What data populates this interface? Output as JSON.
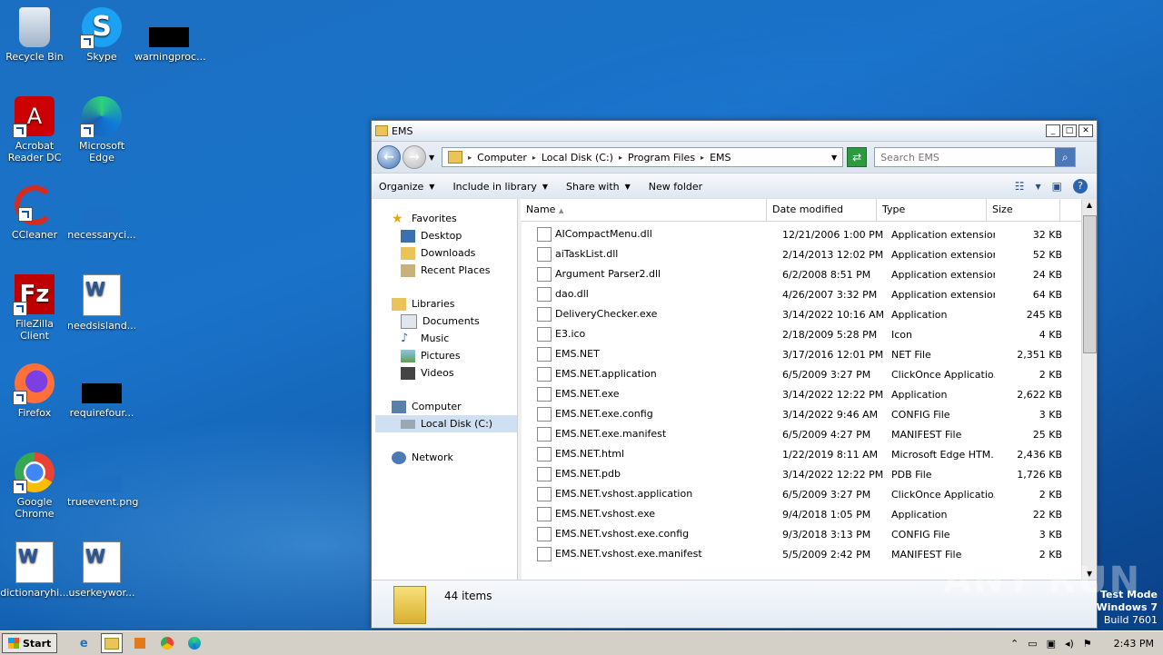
{
  "desktop": {
    "icons": [
      {
        "label": "Recycle Bin"
      },
      {
        "label": "Skype"
      },
      {
        "label": "warningproc..."
      },
      {
        "label": "Acrobat Reader DC"
      },
      {
        "label": "Microsoft Edge"
      },
      {
        "label": "CCleaner"
      },
      {
        "label": "necessaryci..."
      },
      {
        "label": "FileZilla Client"
      },
      {
        "label": "needsisland..."
      },
      {
        "label": "Firefox"
      },
      {
        "label": "requirefour..."
      },
      {
        "label": "Google Chrome"
      },
      {
        "label": "trueevent.png"
      },
      {
        "label": "dictionaryhi..."
      },
      {
        "label": "userkeywor..."
      }
    ]
  },
  "window": {
    "title": "EMS",
    "address": [
      "Computer",
      "Local Disk (C:)",
      "Program Files",
      "EMS"
    ],
    "search_placeholder": "Search EMS",
    "toolbar": {
      "organize": "Organize",
      "include": "Include in library",
      "share": "Share with",
      "new_folder": "New folder"
    },
    "nav": {
      "favorites": "Favorites",
      "desktop": "Desktop",
      "downloads": "Downloads",
      "recent": "Recent Places",
      "libraries": "Libraries",
      "documents": "Documents",
      "music": "Music",
      "pictures": "Pictures",
      "videos": "Videos",
      "computer": "Computer",
      "localdisk": "Local Disk (C:)",
      "network": "Network"
    },
    "columns": {
      "name": "Name",
      "date": "Date modified",
      "type": "Type",
      "size": "Size"
    },
    "files": [
      {
        "name": "AICompactMenu.dll",
        "date": "12/21/2006 1:00 PM",
        "type": "Application extension",
        "size": "32 KB"
      },
      {
        "name": "aiTaskList.dll",
        "date": "2/14/2013 12:02 PM",
        "type": "Application extension",
        "size": "52 KB"
      },
      {
        "name": "Argument Parser2.dll",
        "date": "6/2/2008 8:51 PM",
        "type": "Application extension",
        "size": "24 KB"
      },
      {
        "name": "dao.dll",
        "date": "4/26/2007 3:32 PM",
        "type": "Application extension",
        "size": "64 KB"
      },
      {
        "name": "DeliveryChecker.exe",
        "date": "3/14/2022 10:16 AM",
        "type": "Application",
        "size": "245 KB"
      },
      {
        "name": "E3.ico",
        "date": "2/18/2009 5:28 PM",
        "type": "Icon",
        "size": "4 KB"
      },
      {
        "name": "EMS.NET",
        "date": "3/17/2016 12:01 PM",
        "type": "NET File",
        "size": "2,351 KB"
      },
      {
        "name": "EMS.NET.application",
        "date": "6/5/2009 3:27 PM",
        "type": "ClickOnce Applicatio...",
        "size": "2 KB"
      },
      {
        "name": "EMS.NET.exe",
        "date": "3/14/2022 12:22 PM",
        "type": "Application",
        "size": "2,622 KB"
      },
      {
        "name": "EMS.NET.exe.config",
        "date": "3/14/2022 9:46 AM",
        "type": "CONFIG File",
        "size": "3 KB"
      },
      {
        "name": "EMS.NET.exe.manifest",
        "date": "6/5/2009 4:27 PM",
        "type": "MANIFEST File",
        "size": "25 KB"
      },
      {
        "name": "EMS.NET.html",
        "date": "1/22/2019 8:11 AM",
        "type": "Microsoft Edge HTM...",
        "size": "2,436 KB"
      },
      {
        "name": "EMS.NET.pdb",
        "date": "3/14/2022 12:22 PM",
        "type": "PDB File",
        "size": "1,726 KB"
      },
      {
        "name": "EMS.NET.vshost.application",
        "date": "6/5/2009 3:27 PM",
        "type": "ClickOnce Applicatio...",
        "size": "2 KB"
      },
      {
        "name": "EMS.NET.vshost.exe",
        "date": "9/4/2018 1:05 PM",
        "type": "Application",
        "size": "22 KB"
      },
      {
        "name": "EMS.NET.vshost.exe.config",
        "date": "9/3/2018 3:13 PM",
        "type": "CONFIG File",
        "size": "3 KB"
      },
      {
        "name": "EMS.NET.vshost.exe.manifest",
        "date": "5/5/2009 2:42 PM",
        "type": "MANIFEST File",
        "size": "2 KB"
      }
    ],
    "status": "44 items"
  },
  "taskbar": {
    "start": "Start",
    "clock": "2:43 PM"
  },
  "watermark": {
    "line1": "Test Mode",
    "line2": "Windows 7",
    "line3": "Build 7601",
    "brand": "ANY RUN"
  }
}
